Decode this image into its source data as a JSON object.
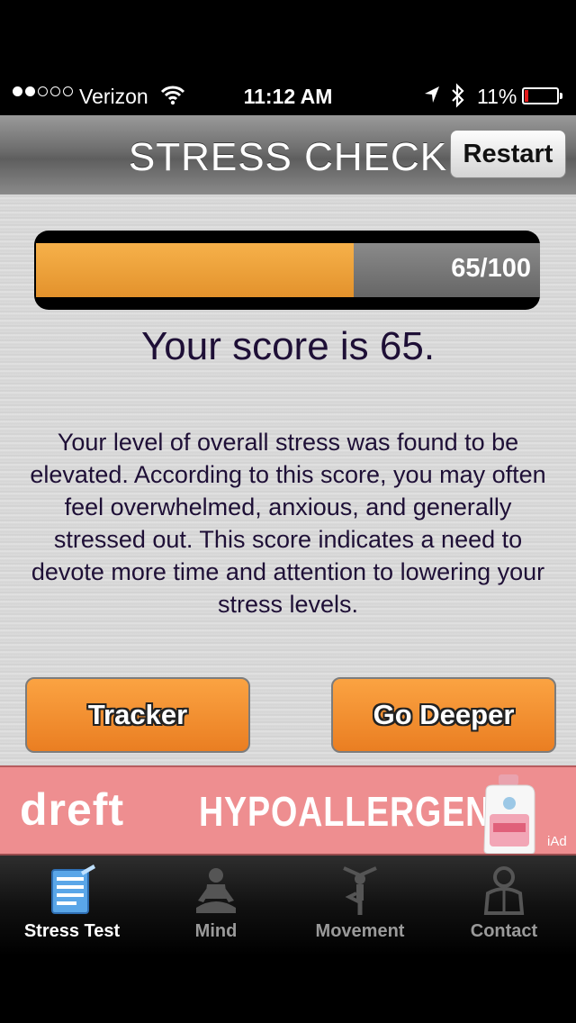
{
  "status_bar": {
    "carrier": "Verizon",
    "time": "11:12 AM",
    "battery": "11%",
    "battery_level": 0.11,
    "signal_bars": 2,
    "signal_total": 5
  },
  "nav": {
    "title": "STRESS CHECK",
    "restart_label": "Restart"
  },
  "score": {
    "value": 65,
    "max": 100,
    "display": "65/100",
    "headline": "Your score is 65.",
    "fill_color": "#f0a540"
  },
  "description": "Your level of overall stress was found to be elevated. According to this score, you may often feel overwhelmed, anxious, and generally stressed out. This score indicates a need to devote more time and attention to lowering your stress levels.",
  "buttons": {
    "tracker": "Tracker",
    "go_deeper": "Go Deeper"
  },
  "ad": {
    "brand": "dreft",
    "slogan": "HYPOALLERGENIC",
    "network": "iAd",
    "background": "#ee8e90"
  },
  "tabs": [
    {
      "label": "Stress Test",
      "icon": "clipboard-icon",
      "active": true
    },
    {
      "label": "Mind",
      "icon": "meditation-icon",
      "active": false
    },
    {
      "label": "Movement",
      "icon": "yoga-pose-icon",
      "active": false
    },
    {
      "label": "Contact",
      "icon": "person-icon",
      "active": false
    }
  ]
}
